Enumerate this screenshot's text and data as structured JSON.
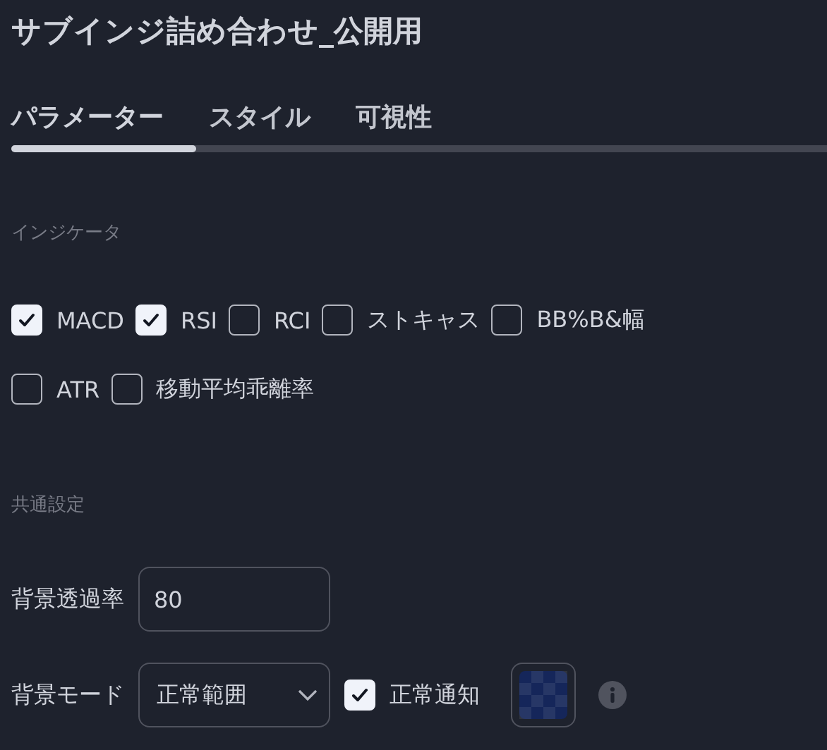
{
  "title": "サブインジ詰め合わせ_公開用",
  "tabs": [
    {
      "label": "パラメーター",
      "selected": true
    },
    {
      "label": "スタイル",
      "selected": false
    },
    {
      "label": "可視性",
      "selected": false
    }
  ],
  "indicators": {
    "heading": "インジケータ",
    "rows": [
      [
        {
          "label": "MACD",
          "checked": true
        },
        {
          "label": "RSI",
          "checked": true
        },
        {
          "label": "RCI",
          "checked": false
        },
        {
          "label": "ストキャス",
          "checked": false
        },
        {
          "label": "BB%B&幅",
          "checked": false
        }
      ],
      [
        {
          "label": "ATR",
          "checked": false
        },
        {
          "label": "移動平均乖離率",
          "checked": false
        }
      ]
    ]
  },
  "common": {
    "heading": "共通設定",
    "opacity": {
      "label": "背景透過率",
      "value": "80"
    },
    "mode": {
      "label": "背景モード",
      "value": "正常範囲",
      "notify_label": "正常通知",
      "notify_checked": true,
      "color": "#15265a"
    }
  }
}
